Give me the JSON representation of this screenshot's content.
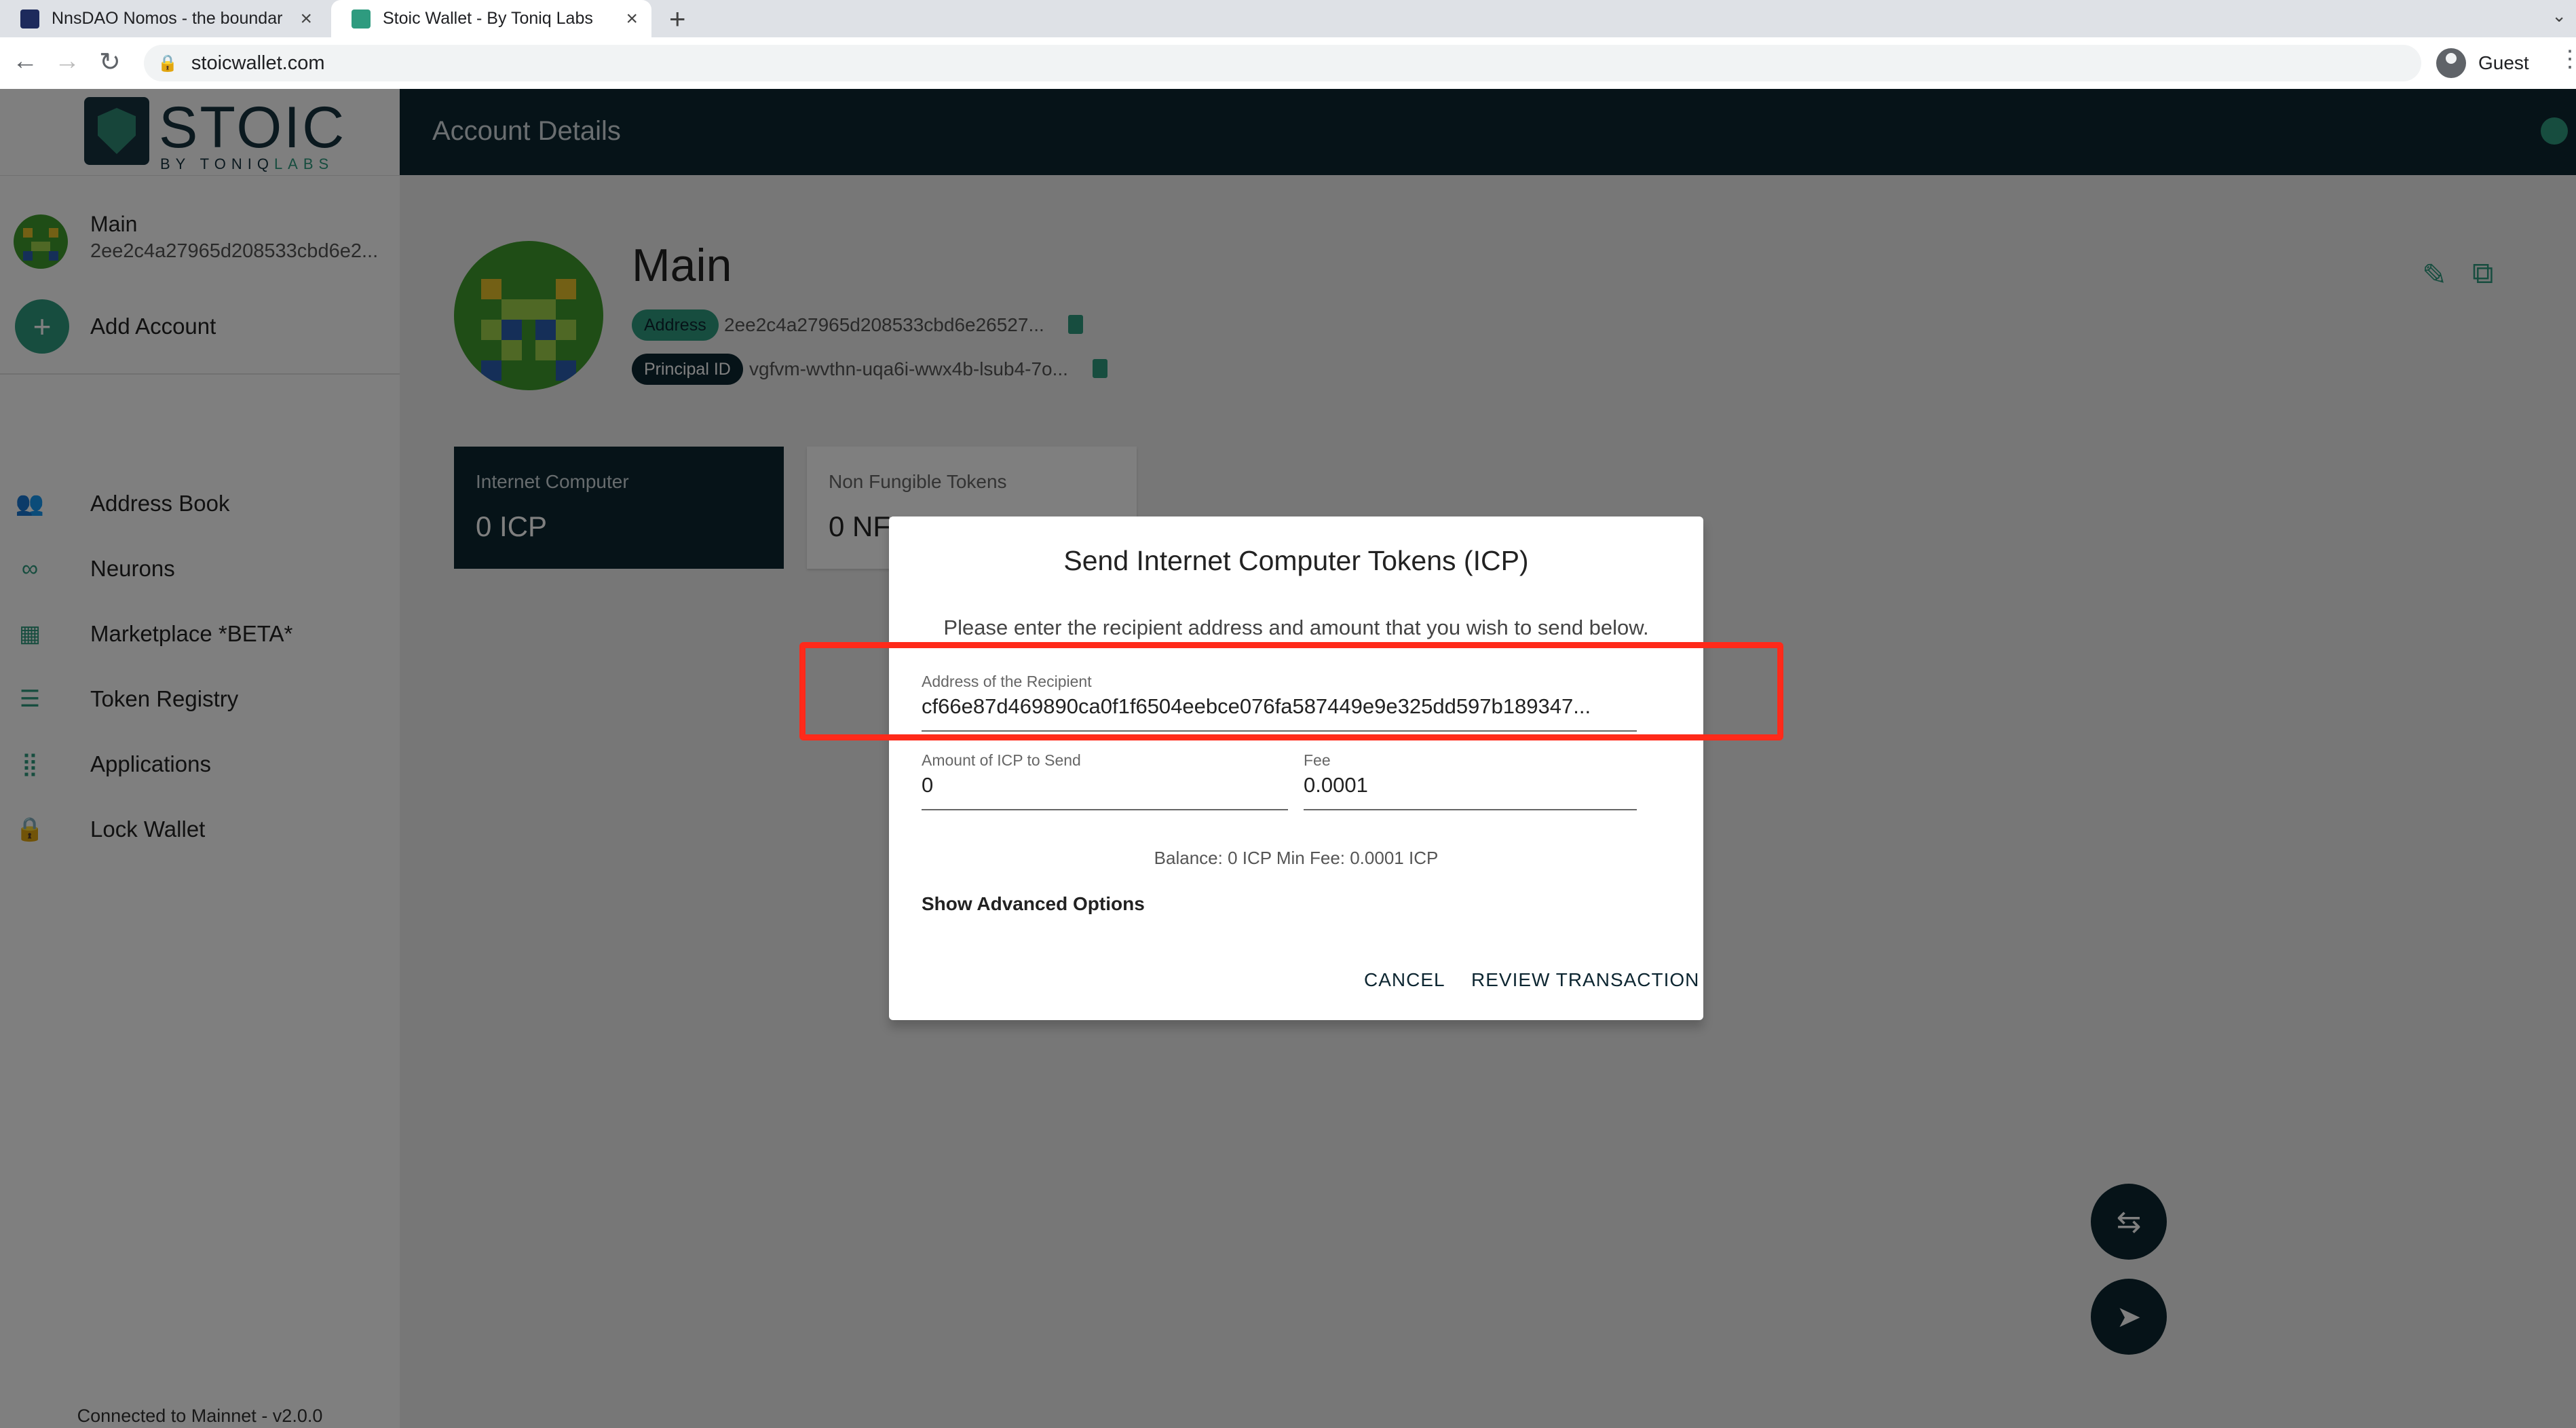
{
  "browser": {
    "tabs": [
      {
        "title": "NnsDAO Nomos - the boundar",
        "active": false,
        "favicon_color": "#1d2a5c"
      },
      {
        "title": "Stoic Wallet - By Toniq Labs",
        "active": true,
        "favicon_color": "#2e9b7f"
      }
    ],
    "url": "stoicwallet.com",
    "profile_label": "Guest"
  },
  "sidebar": {
    "logo_text": "STOIC",
    "logo_sub_prefix": "BY TONIQ",
    "logo_sub_suffix": "LABS",
    "account": {
      "name": "Main",
      "address": "2ee2c4a27965d208533cbd6e2..."
    },
    "add_account_label": "Add Account",
    "items": [
      {
        "label": "Address Book",
        "icon": "people-icon"
      },
      {
        "label": "Neurons",
        "icon": "infinity-icon"
      },
      {
        "label": "Marketplace *BETA*",
        "icon": "store-icon"
      },
      {
        "label": "Token Registry",
        "icon": "list-icon"
      },
      {
        "label": "Applications",
        "icon": "apps-grid-icon"
      },
      {
        "label": "Lock Wallet",
        "icon": "lock-icon"
      }
    ],
    "status": "Connected to Mainnet - v2.0.0"
  },
  "header": {
    "title": "Account Details"
  },
  "account": {
    "name": "Main",
    "address_label": "Address",
    "address": "2ee2c4a27965d208533cbd6e26527...",
    "principal_label": "Principal ID",
    "principal": "vgfvm-wvthn-uqa6i-wwx4b-lsub4-7o..."
  },
  "cards": [
    {
      "label": "Internet Computer",
      "value": "0 ICP"
    },
    {
      "label": "Non Fungible Tokens",
      "value": "0 NFT"
    }
  ],
  "dialog": {
    "title": "Send Internet Computer Tokens (ICP)",
    "description": "Please enter the recipient address and amount that you wish to send below.",
    "recipient_label": "Address of the Recipient",
    "recipient_value": "cf66e87d469890ca0f1f6504eebce076fa587449e9e325dd597b189347...",
    "amount_label": "Amount of ICP to Send",
    "amount_value": "0",
    "fee_label": "Fee",
    "fee_value": "0.0001",
    "balance_text": "Balance: 0 ICP Min Fee: 0.0001 ICP",
    "advanced_label": "Show Advanced Options",
    "cancel_label": "CANCEL",
    "review_label": "REVIEW TRANSACTION"
  },
  "colors": {
    "brand_dark": "#0d2631",
    "accent": "#2e9b7f",
    "highlight": "#ff2a1a"
  }
}
